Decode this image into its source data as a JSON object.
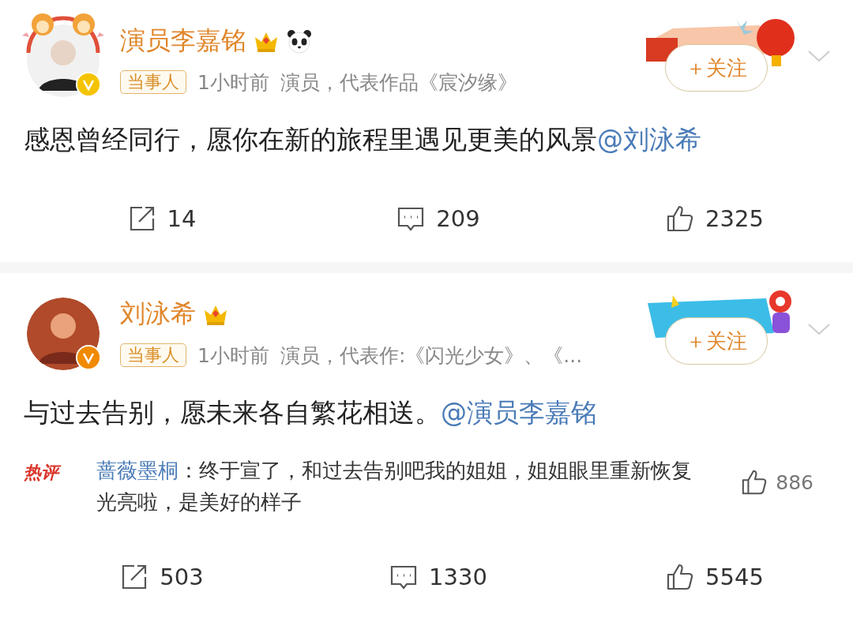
{
  "posts": [
    {
      "author": "演员李嘉铭",
      "avatar_frame": true,
      "verified": {
        "color": "#f5c400"
      },
      "badges": [
        {
          "kind": "crown"
        },
        {
          "kind": "panda"
        }
      ],
      "tag": "当事人",
      "time": "1小时前",
      "description": "演员，代表作品《宸汐缘》",
      "banner": {
        "kind": "festival"
      },
      "follow": "＋关注",
      "text": "感恩曾经同行，愿你在新的旅程里遇见更美的风景",
      "mention": "@刘泳希",
      "actions": [
        {
          "kind": "repost",
          "count": "14"
        },
        {
          "kind": "comment",
          "count": "209"
        },
        {
          "kind": "like",
          "count": "2325"
        }
      ]
    },
    {
      "author": "刘泳希",
      "avatar_frame": false,
      "verified": {
        "color": "#f08a00"
      },
      "badges": [
        {
          "kind": "crown"
        }
      ],
      "tag": "当事人",
      "time": "1小时前",
      "description": "演员，代表作:《闪光少女》、《...",
      "banner": {
        "kind": "charity"
      },
      "follow": "＋关注",
      "text": "与过去告别，愿未来各自繁花相送。",
      "mention": "@演员李嘉铭",
      "hot_comment": {
        "label": "热评",
        "user": "蔷薇墨桐",
        "text": "：终于宣了，和过去告别吧我的姐姐，姐姐眼里重新恢复光亮啦，是美好的样子",
        "likes": "886"
      },
      "actions": [
        {
          "kind": "repost",
          "count": "503"
        },
        {
          "kind": "comment",
          "count": "1330"
        },
        {
          "kind": "like",
          "count": "5545"
        }
      ]
    }
  ]
}
